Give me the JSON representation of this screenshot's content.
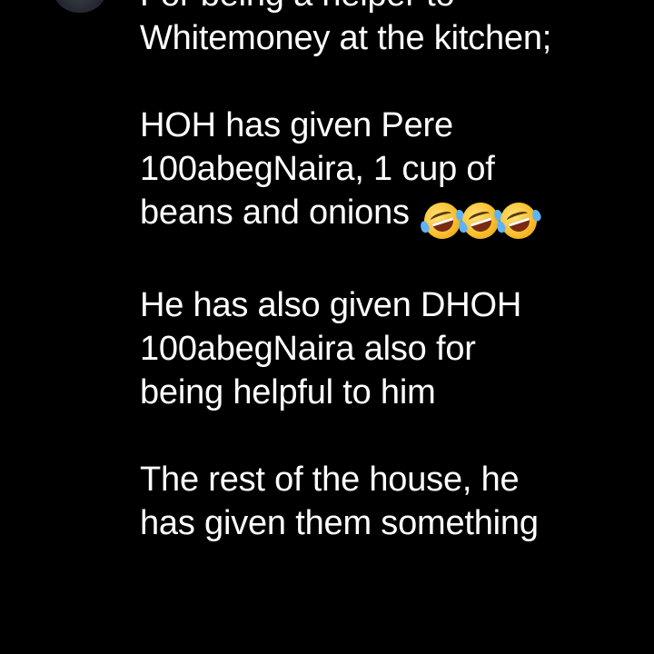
{
  "post": {
    "paragraphs": [
      {
        "lines": [
          "For being a helper to",
          "Whitemoney at the kitchen;"
        ]
      },
      {
        "lines": [
          "HOH has given Pere",
          "100abegNaira, 1 cup of",
          "beans and onions"
        ],
        "trailing_emojis": [
          "rolling-on-floor-laughing",
          "rolling-on-floor-laughing",
          "rolling-on-floor-laughing"
        ]
      },
      {
        "lines": [
          "He has also given DHOH",
          "100abegNaira also for",
          "being helpful to him"
        ]
      },
      {
        "lines": [
          "The rest of the house, he",
          "has given them something"
        ]
      }
    ]
  },
  "colors": {
    "background": "#000000",
    "text": "#ffffff",
    "emoji_face": "#f9c02e",
    "emoji_tear": "#5fb3f5"
  }
}
